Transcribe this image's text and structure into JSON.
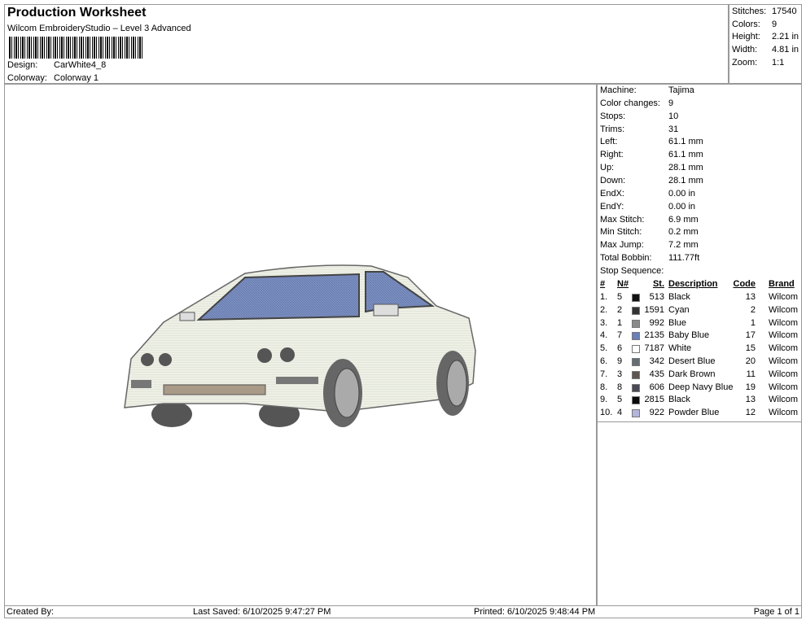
{
  "header": {
    "title": "Production Worksheet",
    "subtitle": "Wilcom EmbroideryStudio – Level 3 Advanced",
    "design_label": "Design:",
    "design": "CarWhite4_8",
    "colorway_label": "Colorway:",
    "colorway": "Colorway 1"
  },
  "stats": [
    {
      "label": "Stitches:",
      "value": "17540"
    },
    {
      "label": "Colors:",
      "value": "9"
    },
    {
      "label": "Height:",
      "value": "2.21 in"
    },
    {
      "label": "Width:",
      "value": "4.81 in"
    },
    {
      "label": "Zoom:",
      "value": "1:1"
    }
  ],
  "machine": [
    {
      "label": "Machine:",
      "value": "Tajima"
    },
    {
      "label": "Color changes:",
      "value": "9"
    },
    {
      "label": "Stops:",
      "value": "10"
    },
    {
      "label": "Trims:",
      "value": "31"
    },
    {
      "label": "Left:",
      "value": "61.1 mm"
    },
    {
      "label": "Right:",
      "value": "61.1 mm"
    },
    {
      "label": "Up:",
      "value": "28.1 mm"
    },
    {
      "label": "Down:",
      "value": "28.1 mm"
    },
    {
      "label": "EndX:",
      "value": "0.00 in"
    },
    {
      "label": "EndY:",
      "value": "0.00 in"
    },
    {
      "label": "Max Stitch:",
      "value": "6.9 mm"
    },
    {
      "label": "Min Stitch:",
      "value": "0.2 mm"
    },
    {
      "label": "Max Jump:",
      "value": "7.2 mm"
    },
    {
      "label": "Total Bobbin:",
      "value": "111.77ft"
    }
  ],
  "sequence": {
    "title": "Stop Sequence:",
    "headers": [
      "#",
      "N#",
      "St.",
      "Description",
      "Code",
      "Brand"
    ],
    "rows": [
      {
        "n": "1.",
        "needle": "5",
        "color": "#111111",
        "st": "513",
        "desc": "Black",
        "code": "13",
        "brand": "Wilcom"
      },
      {
        "n": "2.",
        "needle": "2",
        "color": "#333333",
        "st": "1591",
        "desc": "Cyan",
        "code": "2",
        "brand": "Wilcom"
      },
      {
        "n": "3.",
        "needle": "1",
        "color": "#8a8a8a",
        "st": "992",
        "desc": "Blue",
        "code": "1",
        "brand": "Wilcom"
      },
      {
        "n": "4.",
        "needle": "7",
        "color": "#6a80b8",
        "st": "2135",
        "desc": "Baby Blue",
        "code": "17",
        "brand": "Wilcom"
      },
      {
        "n": "5.",
        "needle": "6",
        "color": "#ffffff",
        "st": "7187",
        "desc": "White",
        "code": "15",
        "brand": "Wilcom"
      },
      {
        "n": "6.",
        "needle": "9",
        "color": "#656d74",
        "st": "342",
        "desc": "Desert Blue",
        "code": "20",
        "brand": "Wilcom"
      },
      {
        "n": "7.",
        "needle": "3",
        "color": "#5e5650",
        "st": "435",
        "desc": "Dark Brown",
        "code": "11",
        "brand": "Wilcom"
      },
      {
        "n": "8.",
        "needle": "8",
        "color": "#4a4a56",
        "st": "606",
        "desc": "Deep Navy Blue",
        "code": "19",
        "brand": "Wilcom"
      },
      {
        "n": "9.",
        "needle": "5",
        "color": "#0a0a0a",
        "st": "2815",
        "desc": "Black",
        "code": "13",
        "brand": "Wilcom"
      },
      {
        "n": "10.",
        "needle": "4",
        "color": "#b4b4dc",
        "st": "922",
        "desc": "Powder Blue",
        "code": "12",
        "brand": "Wilcom"
      }
    ]
  },
  "footer": {
    "created": "Created By:",
    "saved": "Last Saved: 6/10/2025 9:47:27 PM",
    "printed": "Printed: 6/10/2025 9:48:44 PM",
    "page": "Page 1 of 1"
  }
}
